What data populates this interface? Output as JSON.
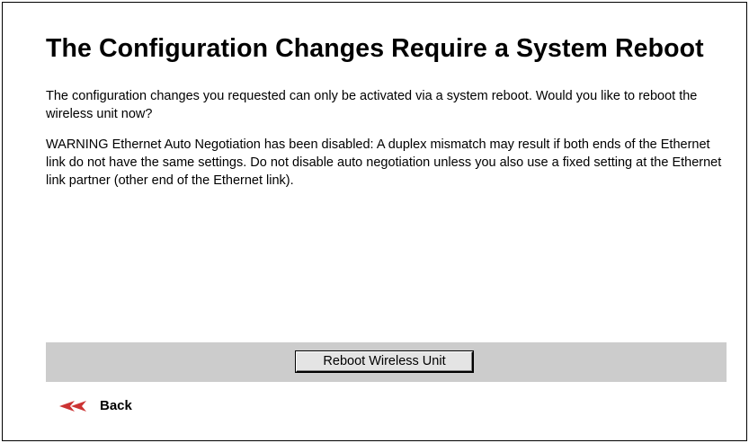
{
  "page": {
    "title": "The Configuration Changes Require a System Reboot",
    "message": "The configuration changes you requested can only be activated via a system reboot. Would you like to reboot the wireless unit now?",
    "warning": "WARNING Ethernet Auto Negotiation has been disabled: A duplex mismatch may result if both ends of the Ethernet link do not have the same settings. Do not disable auto negotiation unless you also use a fixed setting at the Ethernet link partner (other end of the Ethernet link)."
  },
  "actions": {
    "reboot_label": "Reboot Wireless Unit",
    "back_label": "Back",
    "back_icon": "double-left-arrow-icon"
  },
  "colors": {
    "button_bar": "#cccccc",
    "back_arrow": "#cc3333"
  }
}
